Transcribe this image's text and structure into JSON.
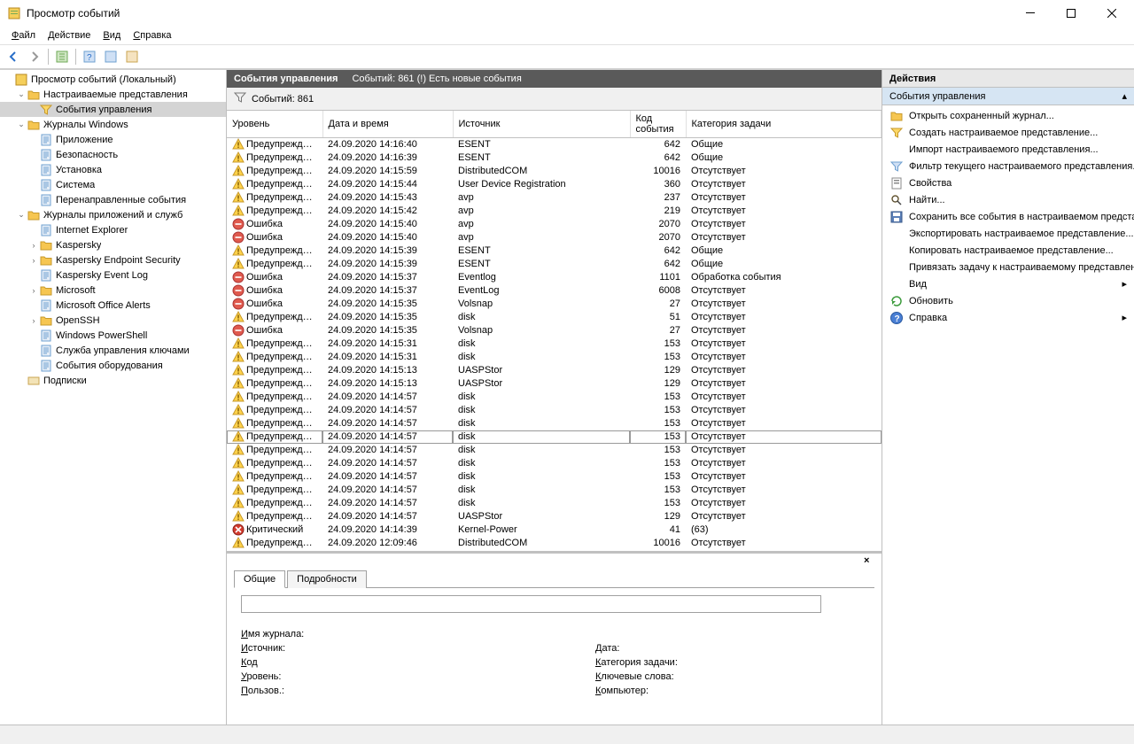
{
  "title": "Просмотр событий",
  "menu": [
    "Файл",
    "Действие",
    "Вид",
    "Справка"
  ],
  "tree": {
    "root": "Просмотр событий (Локальный)",
    "custom_views": "Настраиваемые представления",
    "admin_events": "События управления",
    "windows_logs": "Журналы Windows",
    "win_children": [
      "Приложение",
      "Безопасность",
      "Установка",
      "Система",
      "Перенаправленные события"
    ],
    "app_logs": "Журналы приложений и служб",
    "app_children": [
      "Internet Explorer",
      "Kaspersky",
      "Kaspersky Endpoint Security",
      "Kaspersky Event Log",
      "Microsoft",
      "Microsoft Office Alerts",
      "OpenSSH",
      "Windows PowerShell",
      "Служба управления ключами",
      "События оборудования"
    ],
    "subs": "Подписки"
  },
  "center": {
    "header_title": "События управления",
    "header_count": "Событий: 861 (!) Есть новые события",
    "filter_count": "Событий: 861",
    "columns": [
      "Уровень",
      "Дата и время",
      "Источник",
      "Код события",
      "Категория задачи"
    ]
  },
  "events": [
    {
      "lvl": "warn",
      "level": "Предупреждение",
      "dt": "24.09.2020 14:16:40",
      "src": "ESENT",
      "code": "642",
      "cat": "Общие"
    },
    {
      "lvl": "warn",
      "level": "Предупреждение",
      "dt": "24.09.2020 14:16:39",
      "src": "ESENT",
      "code": "642",
      "cat": "Общие"
    },
    {
      "lvl": "warn",
      "level": "Предупреждение",
      "dt": "24.09.2020 14:15:59",
      "src": "DistributedCOM",
      "code": "10016",
      "cat": "Отсутствует"
    },
    {
      "lvl": "warn",
      "level": "Предупреждение",
      "dt": "24.09.2020 14:15:44",
      "src": "User Device Registration",
      "code": "360",
      "cat": "Отсутствует"
    },
    {
      "lvl": "warn",
      "level": "Предупреждение",
      "dt": "24.09.2020 14:15:43",
      "src": "avp",
      "code": "237",
      "cat": "Отсутствует"
    },
    {
      "lvl": "warn",
      "level": "Предупреждение",
      "dt": "24.09.2020 14:15:42",
      "src": "avp",
      "code": "219",
      "cat": "Отсутствует"
    },
    {
      "lvl": "err",
      "level": "Ошибка",
      "dt": "24.09.2020 14:15:40",
      "src": "avp",
      "code": "2070",
      "cat": "Отсутствует"
    },
    {
      "lvl": "err",
      "level": "Ошибка",
      "dt": "24.09.2020 14:15:40",
      "src": "avp",
      "code": "2070",
      "cat": "Отсутствует"
    },
    {
      "lvl": "warn",
      "level": "Предупреждение",
      "dt": "24.09.2020 14:15:39",
      "src": "ESENT",
      "code": "642",
      "cat": "Общие"
    },
    {
      "lvl": "warn",
      "level": "Предупреждение",
      "dt": "24.09.2020 14:15:39",
      "src": "ESENT",
      "code": "642",
      "cat": "Общие"
    },
    {
      "lvl": "err",
      "level": "Ошибка",
      "dt": "24.09.2020 14:15:37",
      "src": "Eventlog",
      "code": "1101",
      "cat": "Обработка события"
    },
    {
      "lvl": "err",
      "level": "Ошибка",
      "dt": "24.09.2020 14:15:37",
      "src": "EventLog",
      "code": "6008",
      "cat": "Отсутствует"
    },
    {
      "lvl": "err",
      "level": "Ошибка",
      "dt": "24.09.2020 14:15:35",
      "src": "Volsnap",
      "code": "27",
      "cat": "Отсутствует"
    },
    {
      "lvl": "warn",
      "level": "Предупреждение",
      "dt": "24.09.2020 14:15:35",
      "src": "disk",
      "code": "51",
      "cat": "Отсутствует"
    },
    {
      "lvl": "err",
      "level": "Ошибка",
      "dt": "24.09.2020 14:15:35",
      "src": "Volsnap",
      "code": "27",
      "cat": "Отсутствует"
    },
    {
      "lvl": "warn",
      "level": "Предупреждение",
      "dt": "24.09.2020 14:15:31",
      "src": "disk",
      "code": "153",
      "cat": "Отсутствует"
    },
    {
      "lvl": "warn",
      "level": "Предупреждение",
      "dt": "24.09.2020 14:15:31",
      "src": "disk",
      "code": "153",
      "cat": "Отсутствует"
    },
    {
      "lvl": "warn",
      "level": "Предупреждение",
      "dt": "24.09.2020 14:15:13",
      "src": "UASPStor",
      "code": "129",
      "cat": "Отсутствует"
    },
    {
      "lvl": "warn",
      "level": "Предупреждение",
      "dt": "24.09.2020 14:15:13",
      "src": "UASPStor",
      "code": "129",
      "cat": "Отсутствует"
    },
    {
      "lvl": "warn",
      "level": "Предупреждение",
      "dt": "24.09.2020 14:14:57",
      "src": "disk",
      "code": "153",
      "cat": "Отсутствует"
    },
    {
      "lvl": "warn",
      "level": "Предупреждение",
      "dt": "24.09.2020 14:14:57",
      "src": "disk",
      "code": "153",
      "cat": "Отсутствует"
    },
    {
      "lvl": "warn",
      "level": "Предупреждение",
      "dt": "24.09.2020 14:14:57",
      "src": "disk",
      "code": "153",
      "cat": "Отсутствует"
    },
    {
      "lvl": "warn",
      "level": "Предупреждение",
      "dt": "24.09.2020 14:14:57",
      "src": "disk",
      "code": "153",
      "cat": "Отсутствует",
      "sel": true
    },
    {
      "lvl": "warn",
      "level": "Предупреждение",
      "dt": "24.09.2020 14:14:57",
      "src": "disk",
      "code": "153",
      "cat": "Отсутствует"
    },
    {
      "lvl": "warn",
      "level": "Предупреждение",
      "dt": "24.09.2020 14:14:57",
      "src": "disk",
      "code": "153",
      "cat": "Отсутствует"
    },
    {
      "lvl": "warn",
      "level": "Предупреждение",
      "dt": "24.09.2020 14:14:57",
      "src": "disk",
      "code": "153",
      "cat": "Отсутствует"
    },
    {
      "lvl": "warn",
      "level": "Предупреждение",
      "dt": "24.09.2020 14:14:57",
      "src": "disk",
      "code": "153",
      "cat": "Отсутствует"
    },
    {
      "lvl": "warn",
      "level": "Предупреждение",
      "dt": "24.09.2020 14:14:57",
      "src": "disk",
      "code": "153",
      "cat": "Отсутствует"
    },
    {
      "lvl": "warn",
      "level": "Предупреждение",
      "dt": "24.09.2020 14:14:57",
      "src": "UASPStor",
      "code": "129",
      "cat": "Отсутствует"
    },
    {
      "lvl": "crit",
      "level": "Критический",
      "dt": "24.09.2020 14:14:39",
      "src": "Kernel-Power",
      "code": "41",
      "cat": "(63)"
    },
    {
      "lvl": "warn",
      "level": "Предупреждение",
      "dt": "24.09.2020 12:09:46",
      "src": "DistributedCOM",
      "code": "10016",
      "cat": "Отсутствует"
    }
  ],
  "details": {
    "tabs": [
      "Общие",
      "Подробности"
    ],
    "fields": {
      "log_name": "Имя журнала:",
      "source": "Источник:",
      "date": "Дата:",
      "code": "Код",
      "category": "Категория задачи:",
      "level": "Уровень:",
      "keywords": "Ключевые слова:",
      "user": "Пользов.:",
      "computer": "Компьютер:"
    }
  },
  "actions": {
    "title": "Действия",
    "subtitle": "События управления",
    "items": [
      {
        "icon": "open",
        "label": "Открыть сохраненный журнал..."
      },
      {
        "icon": "filter",
        "label": "Создать настраиваемое представление..."
      },
      {
        "icon": "",
        "label": "Импорт настраиваемого представления..."
      },
      {
        "icon": "funnel",
        "label": "Фильтр текущего настраиваемого представления..."
      },
      {
        "icon": "props",
        "label": "Свойства"
      },
      {
        "icon": "find",
        "label": "Найти..."
      },
      {
        "icon": "save",
        "label": "Сохранить все события в настраиваемом представл..."
      },
      {
        "icon": "",
        "label": "Экспортировать настраиваемое представление..."
      },
      {
        "icon": "",
        "label": "Копировать настраиваемое представление..."
      },
      {
        "icon": "",
        "label": "Привязать задачу к настраиваемому представлени..."
      },
      {
        "icon": "",
        "label": "Вид",
        "arrow": true
      },
      {
        "icon": "refresh",
        "label": "Обновить"
      },
      {
        "icon": "help",
        "label": "Справка",
        "arrow": true
      }
    ]
  }
}
